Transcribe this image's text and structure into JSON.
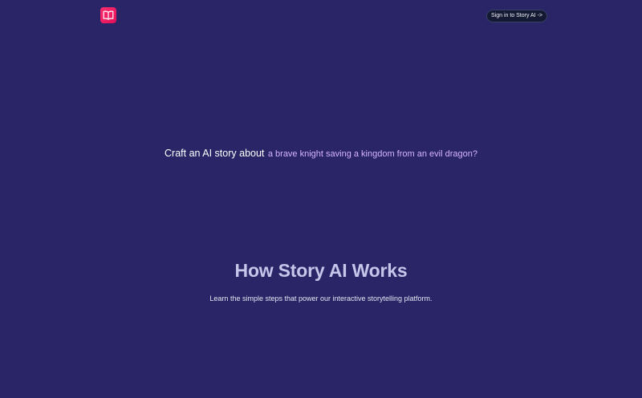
{
  "header": {
    "logo_icon": "book-open-icon",
    "signin_label": "Sign in to Story AI ->"
  },
  "hero": {
    "lead": "Craft an AI story about",
    "topic": "a brave knight saving a kingdom from an evil dragon?"
  },
  "how_it_works": {
    "title": "How Story AI Works",
    "subtitle": "Learn the simple steps that power our interactive storytelling platform."
  },
  "colors": {
    "background": "#292567",
    "logo_gradient_start": "#ff2e6e",
    "logo_gradient_end": "#e0105a",
    "signin_background": "#141a33",
    "topic_text": "#d7b4ff",
    "title_text": "#c5c6ea"
  }
}
